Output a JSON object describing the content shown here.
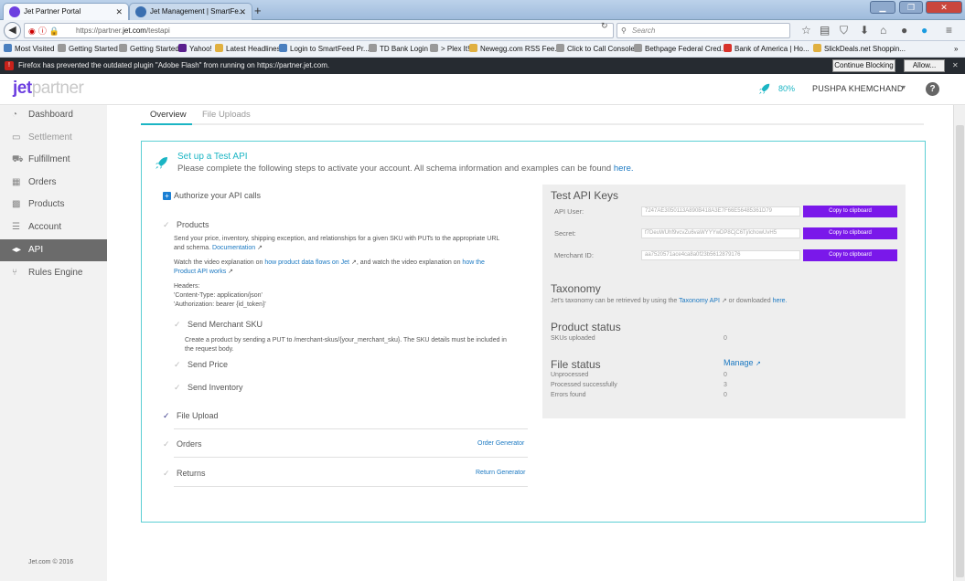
{
  "browser": {
    "tabs": [
      {
        "title": "Jet Partner Portal",
        "active": true
      },
      {
        "title": "Jet Management | SmartFe...",
        "active": false
      }
    ],
    "url_prefix": "https://partner.",
    "url_domain": "jet.com",
    "url_path": "/testapi",
    "search_placeholder": "Search",
    "bookmarks": [
      "Most Visited",
      "Getting Started",
      "Getting Started",
      "Yahoo!",
      "Latest Headlines",
      "Login to SmartFeed Pr...",
      "TD Bank Login",
      "> Plex It!",
      "Newegg.com RSS Fee...",
      "Click to Call Console",
      "Bethpage Federal Cred...",
      "Bank of America | Ho...",
      "SlickDeals.net Shoppin..."
    ],
    "flash_message": "Firefox has prevented the outdated plugin \"Adobe Flash\" from running on https://partner.jet.com.",
    "continue_blocking": "Continue Blocking",
    "allow": "Allow..."
  },
  "header": {
    "logo_jet": "jet",
    "logo_partner": "partner",
    "progress": "80%",
    "user": "PUSHPA KHEMCHAND",
    "help": "?"
  },
  "sidebar": {
    "items": [
      {
        "label": "Dashboard",
        "icon": "dashboard-icon"
      },
      {
        "label": "Settlement",
        "icon": "settlement-icon"
      },
      {
        "label": "Fulfillment",
        "icon": "fulfillment-icon"
      },
      {
        "label": "Orders",
        "icon": "orders-icon"
      },
      {
        "label": "Products",
        "icon": "products-icon"
      },
      {
        "label": "Account",
        "icon": "account-icon"
      },
      {
        "label": "API",
        "icon": "api-icon"
      },
      {
        "label": "Rules Engine",
        "icon": "rules-icon"
      }
    ],
    "copyright": "Jet.com © 2016"
  },
  "tabs": {
    "overview": "Overview",
    "file_uploads": "File Uploads"
  },
  "setup": {
    "title": "Set up a Test API",
    "subtitle": "Please complete the following steps to activate your account. All schema information and examples can be found",
    "here": "here."
  },
  "steps": {
    "authorize": "Authorize your API calls",
    "products": "Products",
    "products_desc_1": "Send your price, inventory, shipping exception, and relationships for a given SKU with PUTs to the appropriate URL",
    "products_desc_2": "and schema.",
    "documentation": "Documentation",
    "video_1": "Watch the video explanation on",
    "video_link_1": "how product data flows on Jet",
    "video_2": ", and watch the video explanation on",
    "video_link_2a": "how the",
    "video_link_2b": "Product API works",
    "headers_1": "Headers:",
    "headers_2": "'Content-Type: application/json'",
    "headers_3": "'Authorization: bearer {id_token}'",
    "send_sku": "Send Merchant SKU",
    "sku_desc_1": "Create a product by sending a PUT to /merchant-skus/{your_merchant_sku}. The SKU details must be included in",
    "sku_desc_2": "the request body.",
    "send_price": "Send Price",
    "send_inventory": "Send Inventory",
    "file_upload": "File Upload",
    "orders": "Orders",
    "order_generator": "Order Generator",
    "returns": "Returns",
    "return_generator": "Return Generator"
  },
  "api_keys": {
    "title": "Test API Keys",
    "api_user_label": "API User:",
    "api_user_value": "7247AE3050113A890B418A3E7F66E56485361D79",
    "secret_label": "Secret:",
    "secret_value": "f7DeuWUhf9vcvZu6vaWYYYwDP8CjC6Tj/ichowUvH5",
    "merchant_label": "Merchant ID:",
    "merchant_value": "aa7520571ace4ca8a0f23b5612879176",
    "copy_btn": "Copy to clipboard",
    "taxonomy_title": "Taxonomy",
    "taxonomy_text": "Jet's taxonomy can be retrieved by using the",
    "taxonomy_api": "Taxonomy API",
    "taxonomy_or": "or downloaded",
    "taxonomy_here": "here.",
    "product_status_title": "Product status",
    "skus_uploaded": "SKUs uploaded",
    "skus_uploaded_val": "0",
    "file_status_title": "File status",
    "manage": "Manage",
    "unprocessed": "Unprocessed",
    "unprocessed_val": "0",
    "processed": "Processed successfully",
    "processed_val": "3",
    "errors": "Errors found",
    "errors_val": "0"
  },
  "colors": {
    "accent": "#1bb5c4",
    "brand": "#6d3fe0",
    "button": "#7a18ea",
    "link": "#1a78c2"
  }
}
